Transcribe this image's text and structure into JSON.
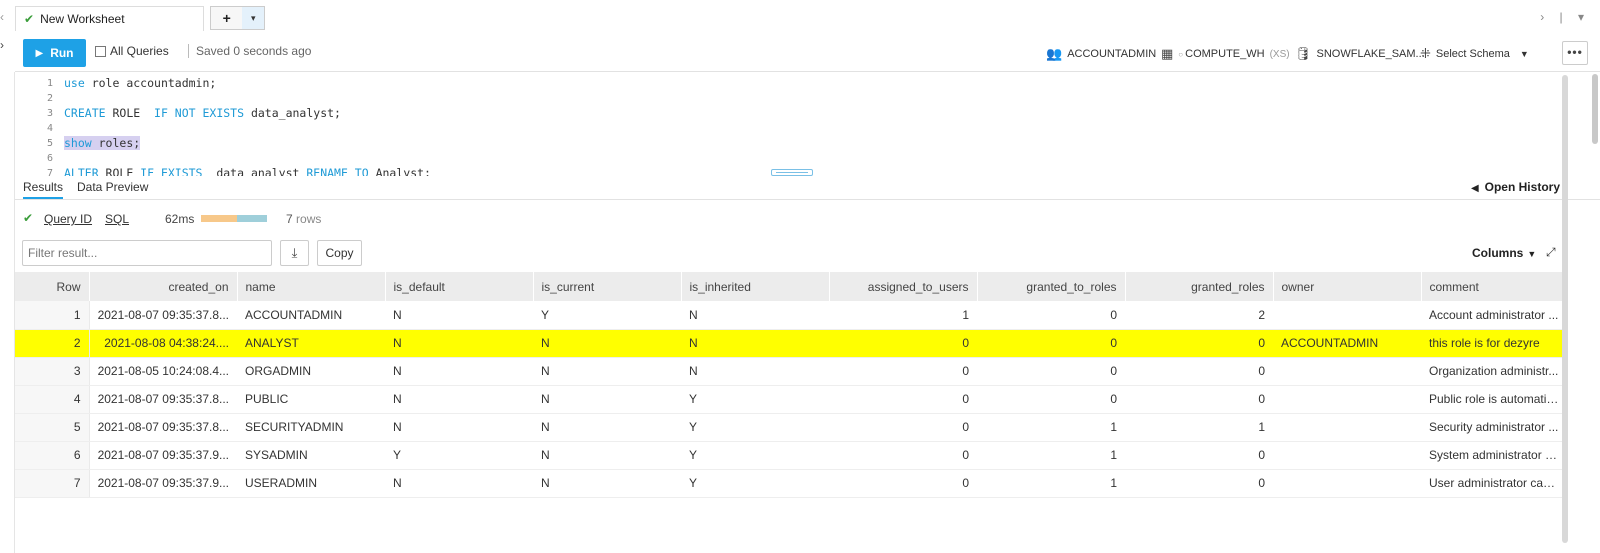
{
  "tabbar": {
    "left_arrow": "‹",
    "tab_title": "New Worksheet",
    "add_label": "+",
    "add_caret": "▾",
    "right_controls": "› | ▾",
    "rail_arrow": "›"
  },
  "toolbar": {
    "run_label": "Run",
    "all_queries_label": "All Queries",
    "saved_status": "Saved 0 seconds ago",
    "role": "ACCOUNTADMIN",
    "warehouse": "COMPUTE_WH",
    "warehouse_size": "(XS)",
    "database": "SNOWFLAKE_SAM...",
    "schema": "Select Schema",
    "more_label": "•••"
  },
  "editor": {
    "lines": [
      {
        "n": "1",
        "parts": [
          {
            "t": "use",
            "k": true
          },
          {
            "t": " role accountadmin;"
          }
        ]
      },
      {
        "n": "2",
        "parts": []
      },
      {
        "n": "3",
        "parts": [
          {
            "t": "CREATE",
            "k": true
          },
          {
            "t": " ROLE  "
          },
          {
            "t": "IF NOT EXISTS",
            "k": true
          },
          {
            "t": " data_analyst;"
          }
        ]
      },
      {
        "n": "4",
        "parts": []
      },
      {
        "n": "5",
        "parts": [
          {
            "t": "show",
            "k": true,
            "s": true
          },
          {
            "t": " roles;",
            "s": true
          }
        ]
      },
      {
        "n": "6",
        "parts": []
      },
      {
        "n": "7",
        "parts": [
          {
            "t": "ALTER",
            "k": true
          },
          {
            "t": " ROLE "
          },
          {
            "t": "IF EXISTS",
            "k": true
          },
          {
            "t": "  data_analyst "
          },
          {
            "t": "RENAME TO",
            "k": true
          },
          {
            "t": " Analyst;"
          }
        ]
      }
    ]
  },
  "results": {
    "tab_results": "Results",
    "tab_preview": "Data Preview",
    "open_history": "Open History",
    "query_id_label": "Query ID",
    "sql_label": "SQL",
    "duration": "62ms",
    "duration_split": [
      0.55,
      0.45
    ],
    "row_count": "7",
    "rows_word": "rows",
    "filter_placeholder": "Filter result...",
    "copy_label": "Copy",
    "columns_label": "Columns",
    "colors": {
      "compile": "#f7c88a",
      "execute": "#9fcfda",
      "highlight": "#ffff00",
      "accent": "#1ea1e6"
    }
  },
  "table": {
    "headers": [
      "Row",
      "created_on",
      "name",
      "is_default",
      "is_current",
      "is_inherited",
      "assigned_to_users",
      "granted_to_roles",
      "granted_roles",
      "owner",
      "comment"
    ],
    "rows": [
      [
        "1",
        "2021-08-07 09:35:37.8...",
        "ACCOUNTADMIN",
        "N",
        "Y",
        "N",
        "1",
        "0",
        "2",
        "",
        "Account administrator ..."
      ],
      [
        "2",
        "2021-08-08 04:38:24....",
        "ANALYST",
        "N",
        "N",
        "N",
        "0",
        "0",
        "0",
        "ACCOUNTADMIN",
        "this role is for dezyre"
      ],
      [
        "3",
        "2021-08-05 10:24:08.4...",
        "ORGADMIN",
        "N",
        "N",
        "N",
        "0",
        "0",
        "0",
        "",
        "Organization administr..."
      ],
      [
        "4",
        "2021-08-07 09:35:37.8...",
        "PUBLIC",
        "N",
        "N",
        "Y",
        "0",
        "0",
        "0",
        "",
        "Public role is automatic..."
      ],
      [
        "5",
        "2021-08-07 09:35:37.8...",
        "SECURITYADMIN",
        "N",
        "N",
        "Y",
        "0",
        "1",
        "1",
        "",
        "Security administrator ..."
      ],
      [
        "6",
        "2021-08-07 09:35:37.9...",
        "SYSADMIN",
        "Y",
        "N",
        "Y",
        "0",
        "1",
        "0",
        "",
        "System administrator c..."
      ],
      [
        "7",
        "2021-08-07 09:35:37.9...",
        "USERADMIN",
        "N",
        "N",
        "Y",
        "0",
        "1",
        "0",
        "",
        "User administrator can ..."
      ]
    ],
    "highlighted_row": 1
  }
}
